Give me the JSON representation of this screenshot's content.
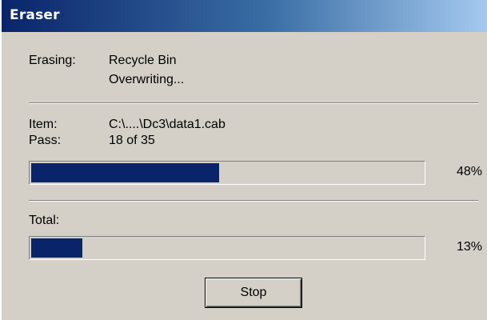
{
  "window": {
    "title": "Eraser"
  },
  "status": {
    "erasing_label": "Erasing:",
    "erasing_target": "Recycle Bin",
    "action": "Overwriting..."
  },
  "item": {
    "item_label": "Item:",
    "item_value": "C:\\....\\Dc3\\data1.cab",
    "pass_label": "Pass:",
    "pass_value": "18 of 35",
    "progress_percent": 48,
    "progress_text": "48%"
  },
  "total": {
    "label": "Total:",
    "progress_percent": 13,
    "progress_text": "13%"
  },
  "buttons": {
    "stop_label": "Stop"
  },
  "colors": {
    "titlebar_start": "#0a246a",
    "titlebar_end": "#a6caf0",
    "progress_fill": "#0a246a",
    "window_bg": "#d4d0c8"
  }
}
